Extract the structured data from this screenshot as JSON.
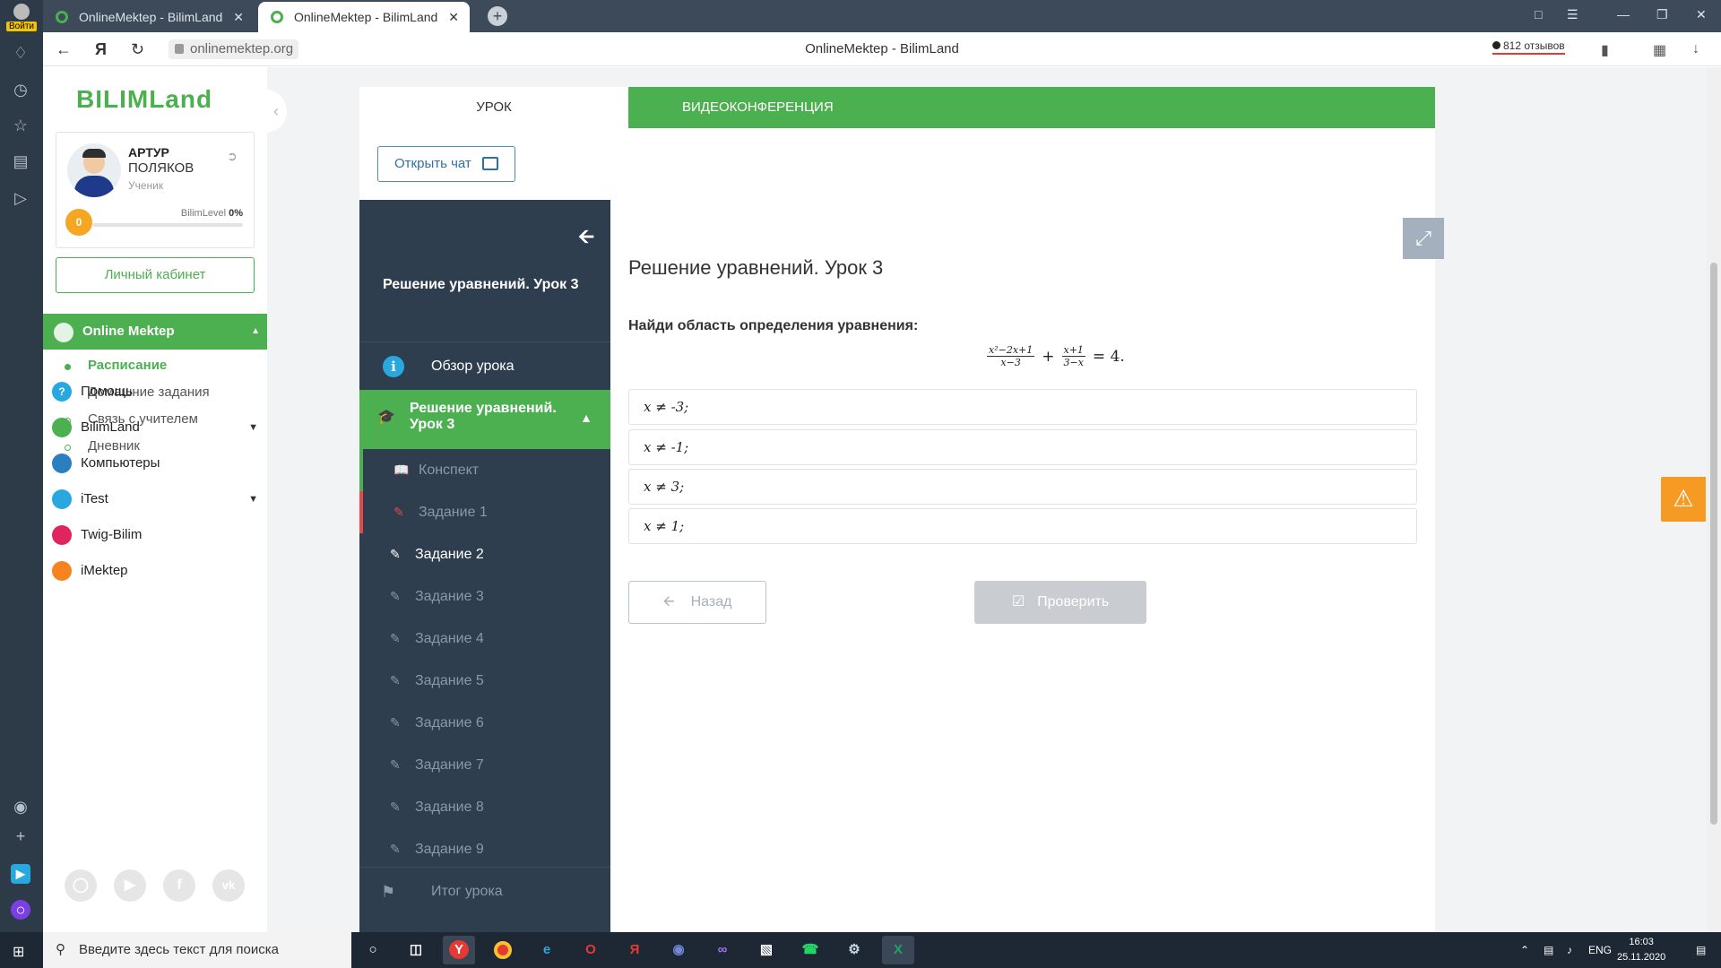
{
  "browser": {
    "login_label": "Войти",
    "tabs": [
      {
        "title": "OnlineMektep - BilimLand",
        "active": false
      },
      {
        "title": "OnlineMektep - BilimLand",
        "active": true
      }
    ],
    "url": "onlinemektep.org",
    "page_title": "OnlineMektep - BilimLand",
    "reviews": "812 отзывов"
  },
  "sidebar": {
    "logo": "BILIMLand",
    "user": {
      "first": "АРТУР",
      "last": "ПОЛЯКОВ",
      "role": "Ученик"
    },
    "level": {
      "badge": "0",
      "label": "BilimLevel",
      "percent": "0%",
      "fraction": 0
    },
    "cabinet_button": "Личный кабинет",
    "section": "Online Mektep",
    "subitems": [
      {
        "label": "Расписание",
        "active": true
      },
      {
        "label": "Домашние задания",
        "active": false
      },
      {
        "label": "Связь с учителем",
        "active": false
      },
      {
        "label": "Дневник",
        "active": false
      }
    ],
    "services": [
      {
        "label": "Помощь",
        "icon": "help-icon",
        "color": "#29a8e0",
        "has_caret": false
      },
      {
        "label": "BilimLand",
        "icon": "bilimland-icon",
        "color": "#4caf50",
        "has_caret": true
      },
      {
        "label": "Компьютеры",
        "icon": "computers-icon",
        "color": "#2a7fc0",
        "has_caret": false
      },
      {
        "label": "iTest",
        "icon": "itest-icon",
        "color": "#29a8e0",
        "has_caret": true
      },
      {
        "label": "Twig-Bilim",
        "icon": "twig-icon",
        "color": "#e0245e",
        "has_caret": false
      },
      {
        "label": "iMektep",
        "icon": "imektep-icon",
        "color": "#f5831f",
        "has_caret": false
      }
    ],
    "social": [
      "instagram-icon",
      "youtube-icon",
      "facebook-icon",
      "vk-icon"
    ]
  },
  "lesson": {
    "tab_lesson": "УРОК",
    "tab_video": "ВИДЕОКОНФЕРЕНЦИЯ",
    "open_chat": "Открыть чат",
    "nav_title": "Решение уравнений. Урок 3",
    "overview": "Обзор урока",
    "current_section": "Решение уравнений. Урок 3",
    "items": [
      {
        "label": "Конспект",
        "state": "done"
      },
      {
        "label": "Задание 1",
        "state": "wrong"
      },
      {
        "label": "Задание 2",
        "state": "active"
      },
      {
        "label": "Задание 3",
        "state": ""
      },
      {
        "label": "Задание 4",
        "state": ""
      },
      {
        "label": "Задание 5",
        "state": ""
      },
      {
        "label": "Задание 6",
        "state": ""
      },
      {
        "label": "Задание 7",
        "state": ""
      },
      {
        "label": "Задание 8",
        "state": ""
      },
      {
        "label": "Задание 9",
        "state": ""
      }
    ],
    "final": "Итог урока",
    "task_title": "Решение уравнений. Урок 3",
    "question": "Найди область определения уравнения:",
    "formula": {
      "frac1_num": "x²−2x+1",
      "frac1_den": "x−3",
      "plus": "+",
      "frac2_num": "x+1",
      "frac2_den": "3−x",
      "rhs": "= 4."
    },
    "options": [
      "x ≠ -3;",
      "x ≠ -1;",
      "x ≠ 3;",
      "x ≠ 1;"
    ],
    "back_button": "Назад",
    "check_button": "Проверить"
  },
  "taskbar": {
    "search_placeholder": "Введите здесь текст для поиска",
    "lang": "ENG",
    "time": "16:03",
    "date": "25.11.2020"
  },
  "colors": {
    "accent": "#4caf50",
    "nav_dark": "#2e3e4f",
    "warning": "#f59a23"
  }
}
